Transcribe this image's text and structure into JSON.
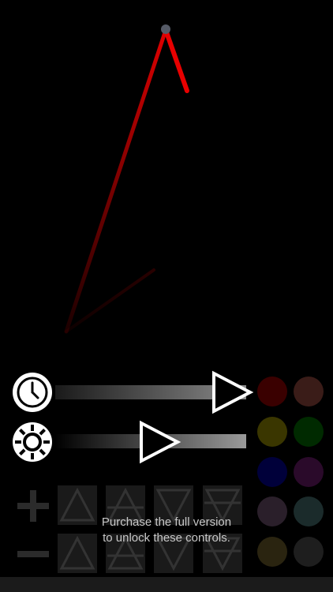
{
  "colors": {
    "background": "#000000",
    "pendulum": "#e00000",
    "swatches": [
      "#3a0000",
      "#3a1c18",
      "#3a3600",
      "#002a00",
      "#00003a",
      "#2a0a2a",
      "#2a1f2a",
      "#1b2b2b",
      "#2a2410",
      "#1e1e1e"
    ]
  },
  "controls": {
    "speed_icon": "clock-icon",
    "brightness_icon": "gear-icon",
    "speed_level": 0.93,
    "brightness_level": 0.55
  },
  "locked_controls": {
    "plus_icon": "plus-icon",
    "minus_icon": "minus-icon",
    "element_icons": [
      "fire-icon",
      "air-icon",
      "water-icon",
      "earth-icon"
    ],
    "message_line1": "Purchase the full version",
    "message_line2": "to unlock these controls."
  }
}
